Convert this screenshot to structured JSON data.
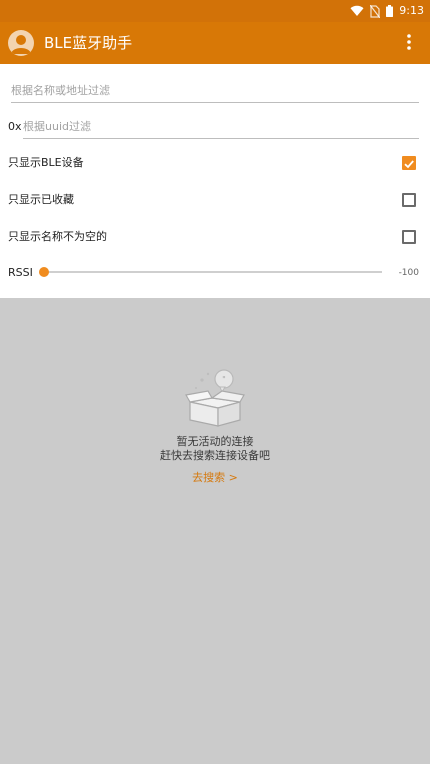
{
  "status_bar": {
    "time": "9:13"
  },
  "app_bar": {
    "title": "BLE蓝牙助手"
  },
  "filters": {
    "name_or_address_placeholder": "根据名称或地址过滤",
    "uuid_prefix": "0x",
    "uuid_placeholder": "根据uuid过滤"
  },
  "options": [
    {
      "label": "只显示BLE设备",
      "checked": true
    },
    {
      "label": "只显示已收藏",
      "checked": false
    },
    {
      "label": "只显示名称不为空的",
      "checked": false
    }
  ],
  "rssi": {
    "label": "RSSI",
    "value": "-100",
    "slider_fraction": 0
  },
  "empty_state": {
    "line1": "暂无活动的连接",
    "line2": "赶快去搜索连接设备吧",
    "link": "去搜索 >"
  },
  "colors": {
    "status_bar": "#d27208",
    "app_bar": "#d87806",
    "accent": "#f08c1f",
    "empty_background": "#cbcbcb"
  }
}
